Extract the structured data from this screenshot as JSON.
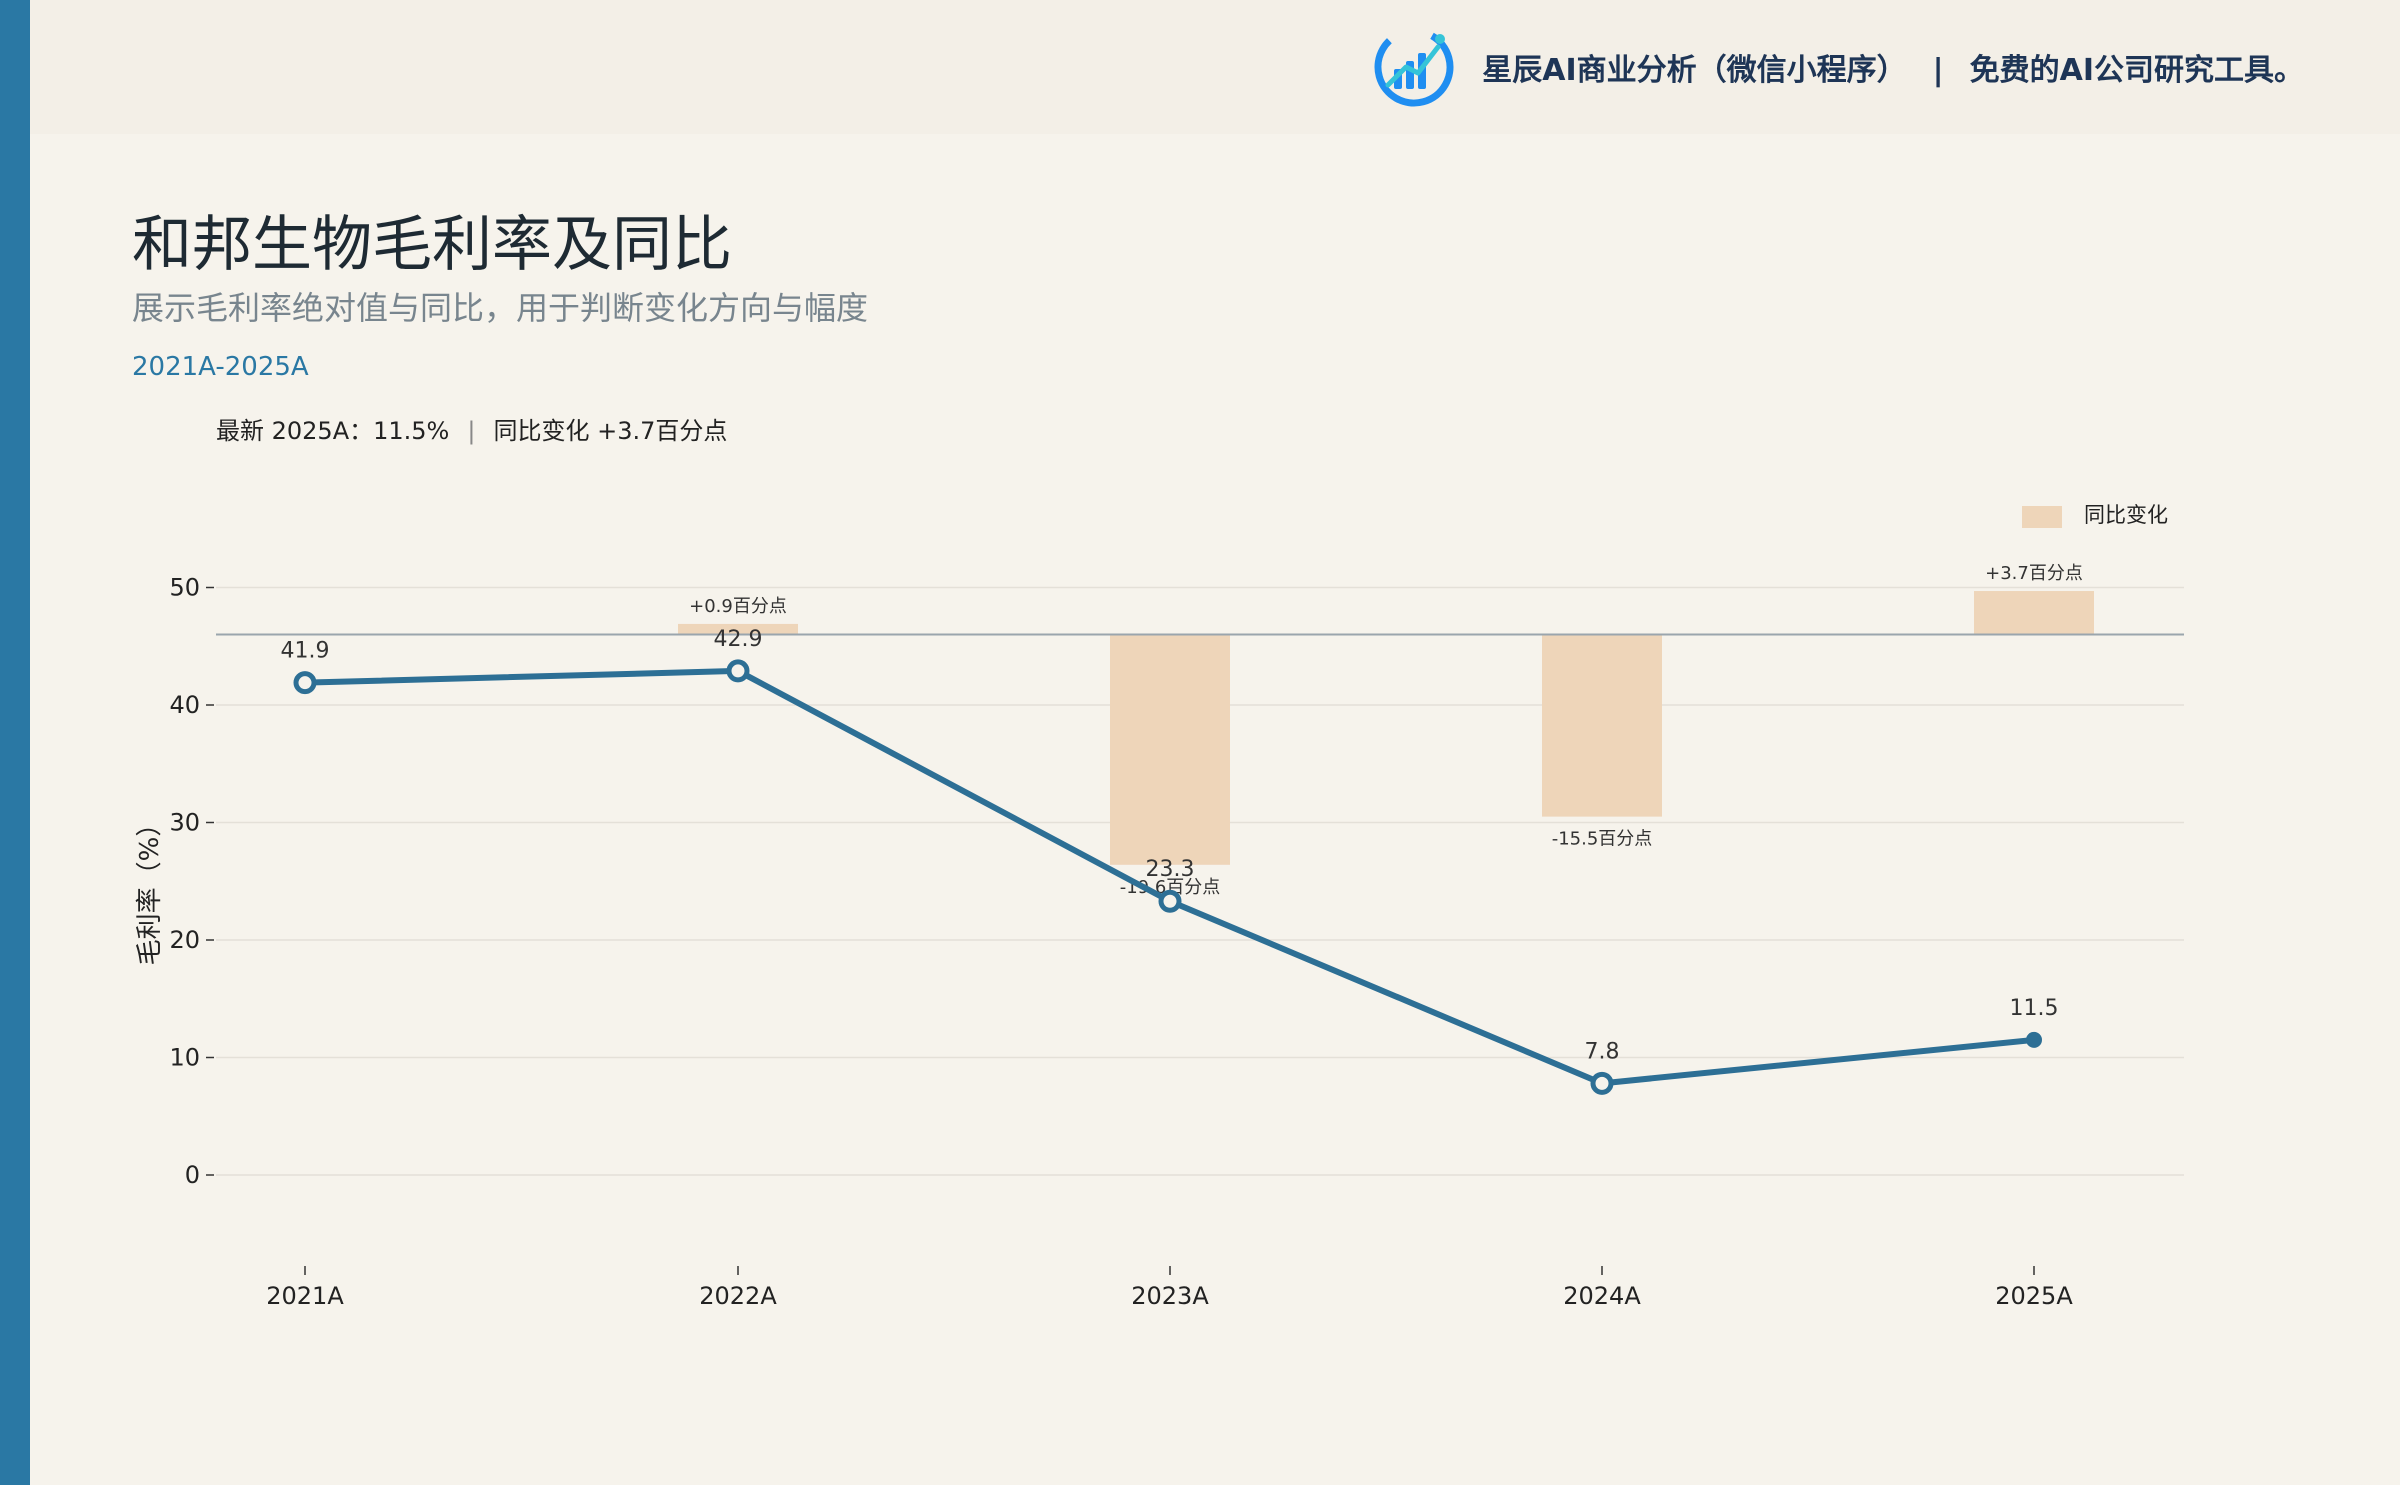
{
  "header": {
    "brand_name": "星辰AI商业分析（微信小程序）",
    "brand_separator": "|",
    "brand_tagline": "免费的AI公司研究工具。",
    "logo_icon": "bar-chart-logo-icon"
  },
  "title": "和邦生物毛利率及同比",
  "subtitle": "展示毛利率绝对值与同比，用于判断变化方向与幅度",
  "range": "2021A-2025A",
  "summary": {
    "latest": "最新 2025A：11.5%",
    "separator": "|",
    "change": "同比变化 +3.7百分点"
  },
  "colors": {
    "accent": "#2a78a4",
    "line": "#2d6f95",
    "bar": "#eed5b9",
    "background": "#f6f3ec"
  },
  "chart_data": {
    "type": "line",
    "categories": [
      "2021A",
      "2022A",
      "2023A",
      "2024A",
      "2025A"
    ],
    "ylabel": "毛利率（%）",
    "ylim": [
      -8,
      60
    ],
    "yticks": [
      0,
      10,
      20,
      30,
      40,
      50
    ],
    "grid": true,
    "series": [
      {
        "values": [
          41.9,
          42.9,
          23.3,
          7.8,
          11.5
        ],
        "labels": [
          "41.9",
          "42.9",
          "23.3",
          "7.8",
          "11.5"
        ]
      }
    ],
    "yoy": {
      "legend": "同比变化",
      "baseline": 46,
      "values": [
        null,
        0.9,
        -19.6,
        -15.5,
        3.7
      ],
      "labels": [
        "",
        "+0.9百分点",
        "-19.6百分点",
        "-15.5百分点",
        "+3.7百分点"
      ]
    }
  }
}
